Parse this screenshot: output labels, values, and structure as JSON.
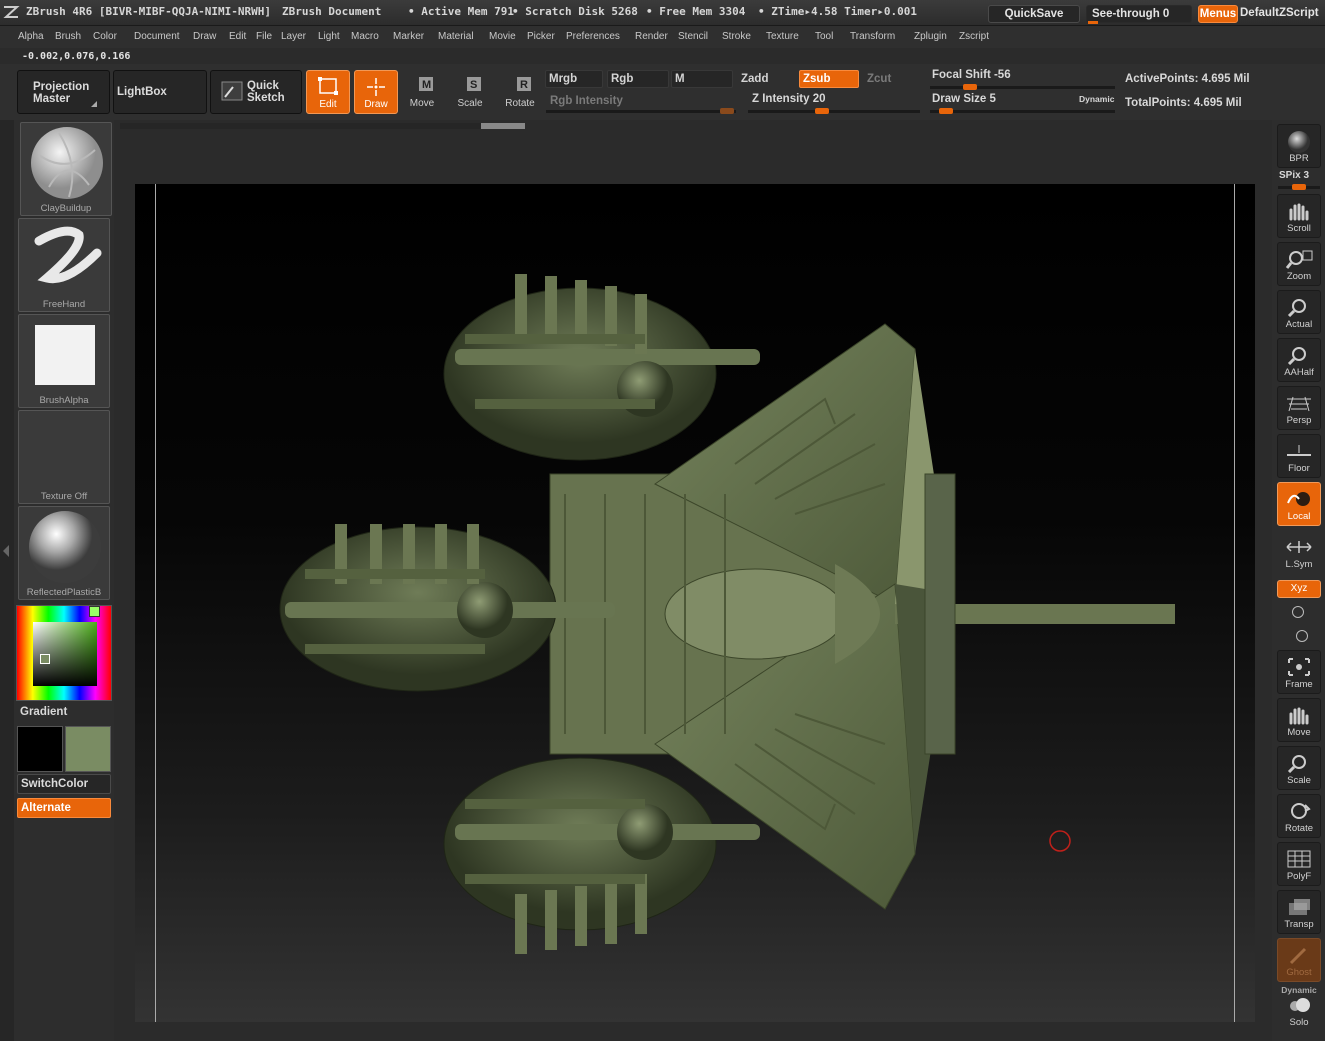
{
  "titlebar": {
    "app": "ZBrush 4R6 [BIVR-MIBF-QQJA-NIMI-NRWH]",
    "document": "ZBrush Document",
    "active_mem": "• Active Mem 791",
    "scratch": "• Scratch Disk 5268",
    "free_mem": "• Free Mem 3304",
    "ztime": "• ZTime▸4.58 Timer▸0.001",
    "quicksave": "QuickSave",
    "seethrough": "See-through  0",
    "menus": "Menus",
    "script": "DefaultZScript"
  },
  "menu": [
    "Alpha",
    "Brush",
    "Color",
    "Document",
    "Draw",
    "Edit",
    "File",
    "Layer",
    "Light",
    "Macro",
    "Marker",
    "Material",
    "Movie",
    "Picker",
    "Preferences",
    "Render",
    "Stencil",
    "Stroke",
    "Texture",
    "Tool",
    "Transform",
    "Zplugin",
    "Zscript"
  ],
  "coords": "-0.002,0.076,0.166",
  "shelf": {
    "projection_master": "Projection Master",
    "lightbox": "LightBox",
    "quick_sketch": "Quick Sketch",
    "edit": "Edit",
    "draw": "Draw",
    "move": "Move",
    "scale": "Scale",
    "rotate": "Rotate",
    "mrgb": "Mrgb",
    "rgb": "Rgb",
    "m": "M",
    "zadd": "Zadd",
    "zsub": "Zsub",
    "zcut": "Zcut",
    "rgb_intensity": "Rgb Intensity",
    "z_intensity": "Z Intensity 20",
    "focal_shift": "Focal Shift -56",
    "draw_size": "Draw Size 5",
    "dynamic": "Dynamic",
    "active_points": "ActivePoints: 4.695 Mil",
    "total_points": "TotalPoints: 4.695 Mil"
  },
  "left": {
    "brush": "ClayBuildup",
    "stroke": "FreeHand",
    "alpha": "BrushAlpha",
    "texture": "Texture  Off",
    "material": "ReflectedPlasticB",
    "gradient": "Gradient",
    "switchcolor": "SwitchColor",
    "alternate": "Alternate",
    "main_color": "#000000",
    "secondary_color": "#7a8c63"
  },
  "right": {
    "bpr": "BPR",
    "spix": "SPix 3",
    "scroll": "Scroll",
    "zoom": "Zoom",
    "actual": "Actual",
    "aahalf": "AAHalf",
    "persp": "Persp",
    "floor": "Floor",
    "local": "Local",
    "lsym": "L.Sym",
    "xyz": "Xyz",
    "frame": "Frame",
    "move": "Move",
    "scale": "Scale",
    "rotate": "Rotate",
    "polyf": "PolyF",
    "transp": "Transp",
    "ghost": "Ghost",
    "dynamic": "Dynamic",
    "solo": "Solo"
  },
  "colors": {
    "accent": "#e8650a",
    "model": "#5d6b47"
  }
}
